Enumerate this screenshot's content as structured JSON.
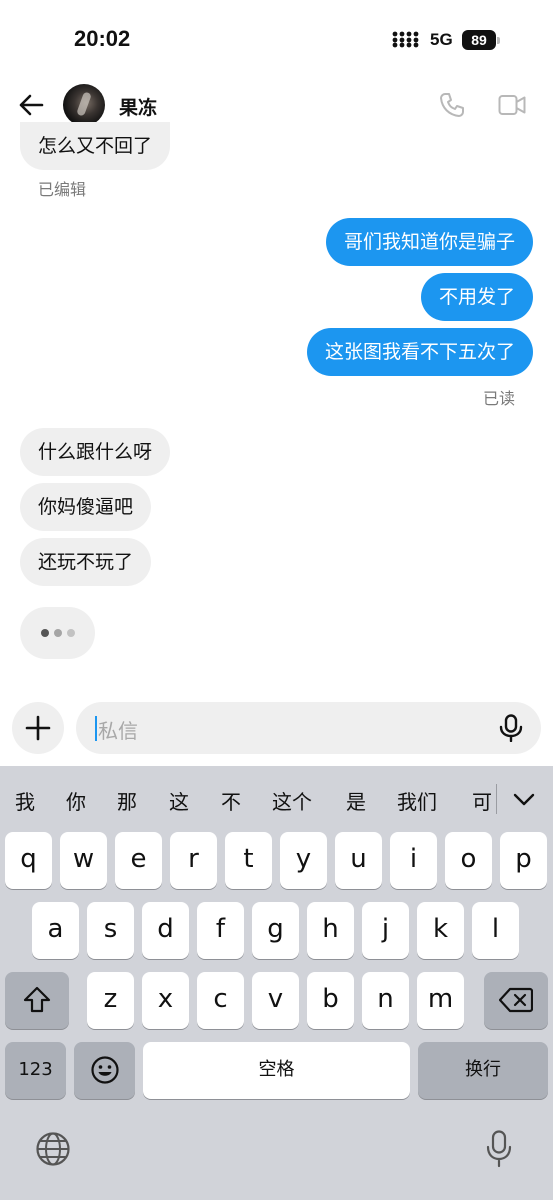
{
  "status_bar": {
    "time": "20:02",
    "network": "5G",
    "battery": "89"
  },
  "header": {
    "contact_name": "果冻"
  },
  "messages": [
    {
      "dir": "in",
      "text": "怎么又不回了"
    },
    {
      "dir": "out",
      "text": "哥们我知道你是骗子"
    },
    {
      "dir": "out",
      "text": "不用发了"
    },
    {
      "dir": "out",
      "text": "这张图我看不下五次了"
    },
    {
      "dir": "in",
      "text": "什么跟什么呀"
    },
    {
      "dir": "in",
      "text": "你妈傻逼吧"
    },
    {
      "dir": "in",
      "text": "还玩不玩了"
    }
  ],
  "meta": {
    "edited": "已编辑",
    "read": "已读"
  },
  "composer": {
    "placeholder": "私信"
  },
  "keyboard": {
    "candidates": [
      "我",
      "你",
      "那",
      "这",
      "不",
      "这个",
      "是",
      "我们",
      "可"
    ],
    "row1": [
      "q",
      "w",
      "e",
      "r",
      "t",
      "y",
      "u",
      "i",
      "o",
      "p"
    ],
    "row2": [
      "a",
      "s",
      "d",
      "f",
      "g",
      "h",
      "j",
      "k",
      "l"
    ],
    "row3": [
      "z",
      "x",
      "c",
      "v",
      "b",
      "n",
      "m"
    ],
    "numbers_label": "123",
    "space_label": "空格",
    "return_label": "换行"
  },
  "colors": {
    "accent": "#1c96f0",
    "incoming_bubble": "#efefef",
    "keyboard_bg": "#d1d3d9"
  }
}
